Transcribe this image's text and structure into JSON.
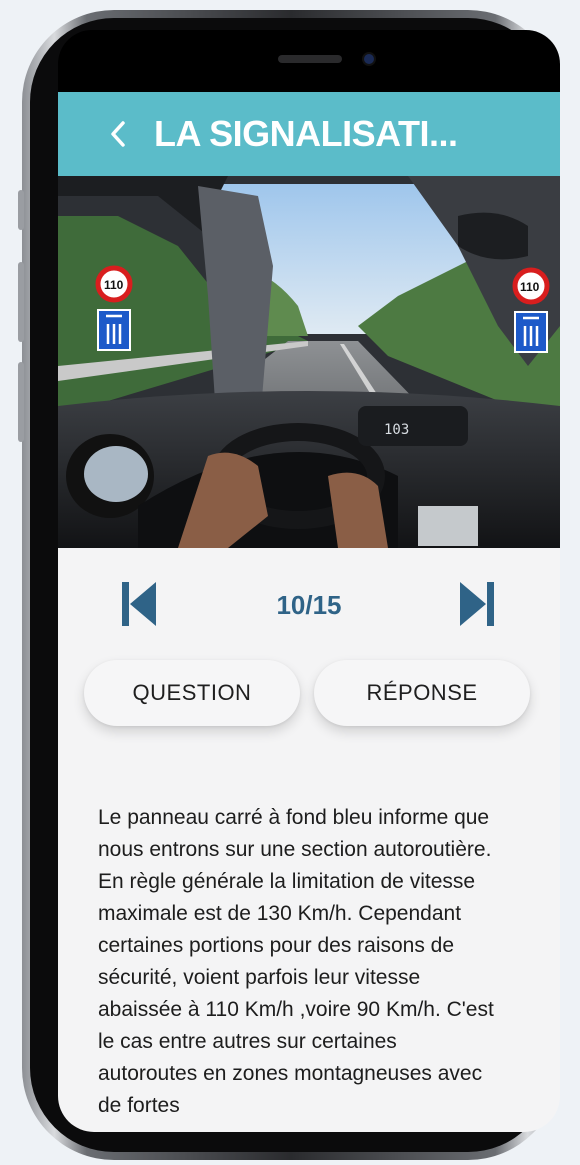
{
  "header": {
    "back_icon": "chevron-left-icon",
    "title": "LA SIGNALISATI..."
  },
  "photo": {
    "description_icon": "car-interior-photo",
    "dashboard_speed": "103",
    "signs": {
      "speed_limit": "110",
      "highway_icon": "motorway-sign-icon"
    }
  },
  "pager": {
    "prev_icon": "skip-previous-icon",
    "next_icon": "skip-next-icon",
    "counter": "10/15"
  },
  "tabs": {
    "question": "QUESTION",
    "reponse": "RÉPONSE"
  },
  "answer": {
    "text": "Le panneau carré à fond bleu informe que nous entrons sur une section autoroutière. En règle générale la limitation de vitesse maximale est de 130 Km/h. Cependant certaines portions pour des raisons de sécurité, voient parfois leur vitesse abaissée à 110 Km/h ,voire 90 Km/h. C'est le cas entre autres sur certaines autoroutes en zones montagneuses avec de fortes"
  },
  "colors": {
    "header": "#5bbcc9",
    "accent": "#2f6387",
    "background": "#f4f4f5"
  }
}
